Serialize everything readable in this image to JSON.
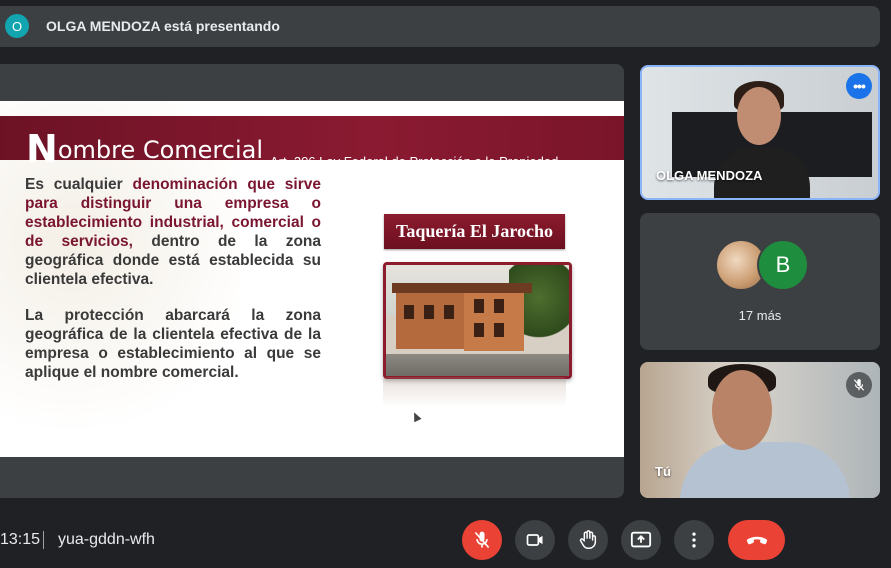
{
  "presenter_bar": {
    "avatar_initial": "O",
    "text": "OLGA MENDOZA está presentando"
  },
  "slide": {
    "title_initial": "N",
    "title_rest": "ombre Comercial",
    "subtitle": "Art. 206 Ley Federal de Protección a la Propiedad",
    "para1_a": "Es cualquier ",
    "para1_b": "denominación que sirve para distinguir una empresa o establecimiento industrial, comercial o de servicios,",
    "para1_c": " dentro de la zona geográfica donde está establecida su clientela efectiva.",
    "para2": "La protección abarcará la zona geográfica de la clientela efectiva de la empresa o establecimiento al que se aplique el nombre comercial.",
    "image_caption": "Taquería El Jarocho"
  },
  "participants": {
    "presenter_name": "OLGA MENDOZA",
    "more_avatar_initial": "B",
    "more_label": "17 más",
    "self_name": "Tú"
  },
  "bottom_bar": {
    "time": "13:15",
    "meeting_code": "yua-gddn-wfh"
  },
  "icons": {
    "mic": "mic-off-icon",
    "camera": "camera-icon",
    "hand": "raise-hand-icon",
    "present": "present-screen-icon",
    "more": "more-options-icon",
    "end": "end-call-icon"
  },
  "colors": {
    "background": "#202124",
    "tile": "#3c4043",
    "danger": "#ea4335",
    "accent": "#1a73e8",
    "slide_accent": "#7a1530"
  }
}
